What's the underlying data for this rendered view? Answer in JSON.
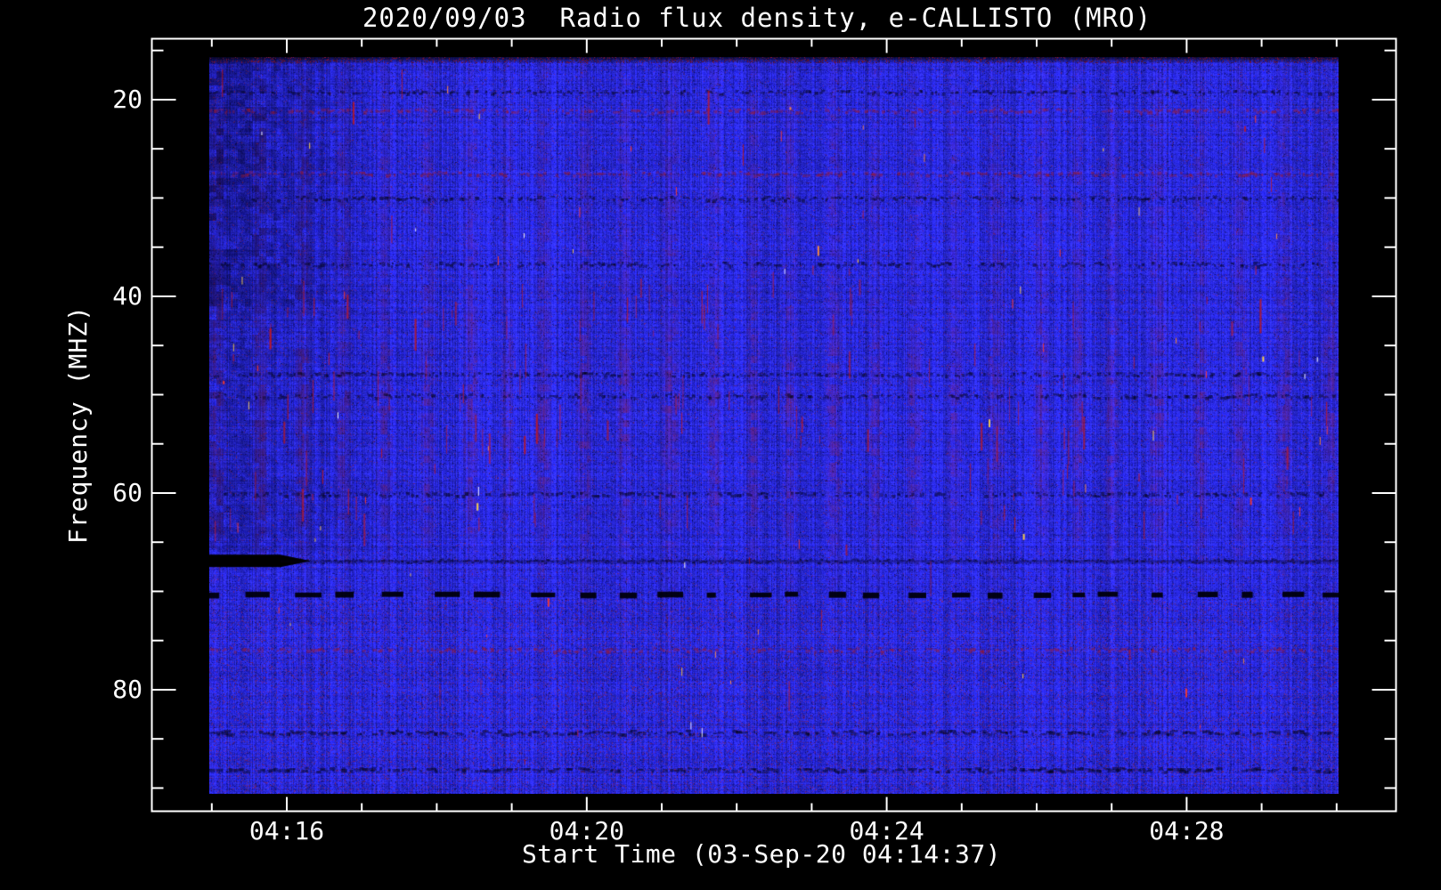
{
  "figure": {
    "background_color": "#000000",
    "text_color": "#ffffff"
  },
  "chart_data": {
    "type": "heatmap",
    "title": "2020/09/03  Radio flux density, e-CALLISTO (MRO)",
    "xlabel": "Start Time (03-Sep-20 04:14:37)",
    "ylabel": "Frequency (MHZ)",
    "date": "2020/09/03",
    "instrument": "e-CALLISTO (MRO)",
    "start_time": "03-Sep-20 04:14:37",
    "x_axis": {
      "major_ticks": [
        {
          "label": "04:16",
          "minute": 16
        },
        {
          "label": "04:20",
          "minute": 20
        },
        {
          "label": "04:24",
          "minute": 24
        },
        {
          "label": "04:28",
          "minute": 28
        }
      ],
      "minor_tick_minutes": [
        15,
        17,
        18,
        19,
        21,
        22,
        23,
        25,
        26,
        27,
        29,
        30
      ]
    },
    "y_axis": {
      "inverted": true,
      "major_ticks": [
        {
          "label": "20",
          "mhz": 20
        },
        {
          "label": "40",
          "mhz": 40
        },
        {
          "label": "60",
          "mhz": 60
        },
        {
          "label": "80",
          "mhz": 80
        }
      ],
      "minor_tick_mhz": [
        15,
        25,
        30,
        35,
        45,
        50,
        55,
        65,
        70,
        75,
        85,
        90
      ]
    },
    "colormap": {
      "base_blue": "#2828da",
      "bright_blue": "#4646ff",
      "dark_navy": "#0a0a80",
      "blotch_red": "#7d1f6a",
      "speck_red": "#a01c32",
      "streak_red": "#c82020",
      "spike_white": "#ffffff",
      "spike_yellow": "#ffd24a",
      "feature_black": "#000000"
    },
    "features": {
      "description": "Blue radio spectrogram with red interference speckle and striping",
      "dark_speckle_rows_mhz": [
        19.2,
        30.0,
        36.7,
        47.9,
        50.1,
        60.1,
        84.3,
        88.1
      ],
      "red_speckle_rows_mhz": [
        21.1,
        27.5,
        75.9
      ],
      "black_band_mhz": 66.9,
      "black_dashed_row_mhz": 70.3,
      "red_blotch_band_mhz": [
        42,
        62
      ],
      "faint_red_band_mhz": [
        18,
        36
      ],
      "dark_patch_region": "low frequencies during first ~2.5 minutes"
    }
  }
}
